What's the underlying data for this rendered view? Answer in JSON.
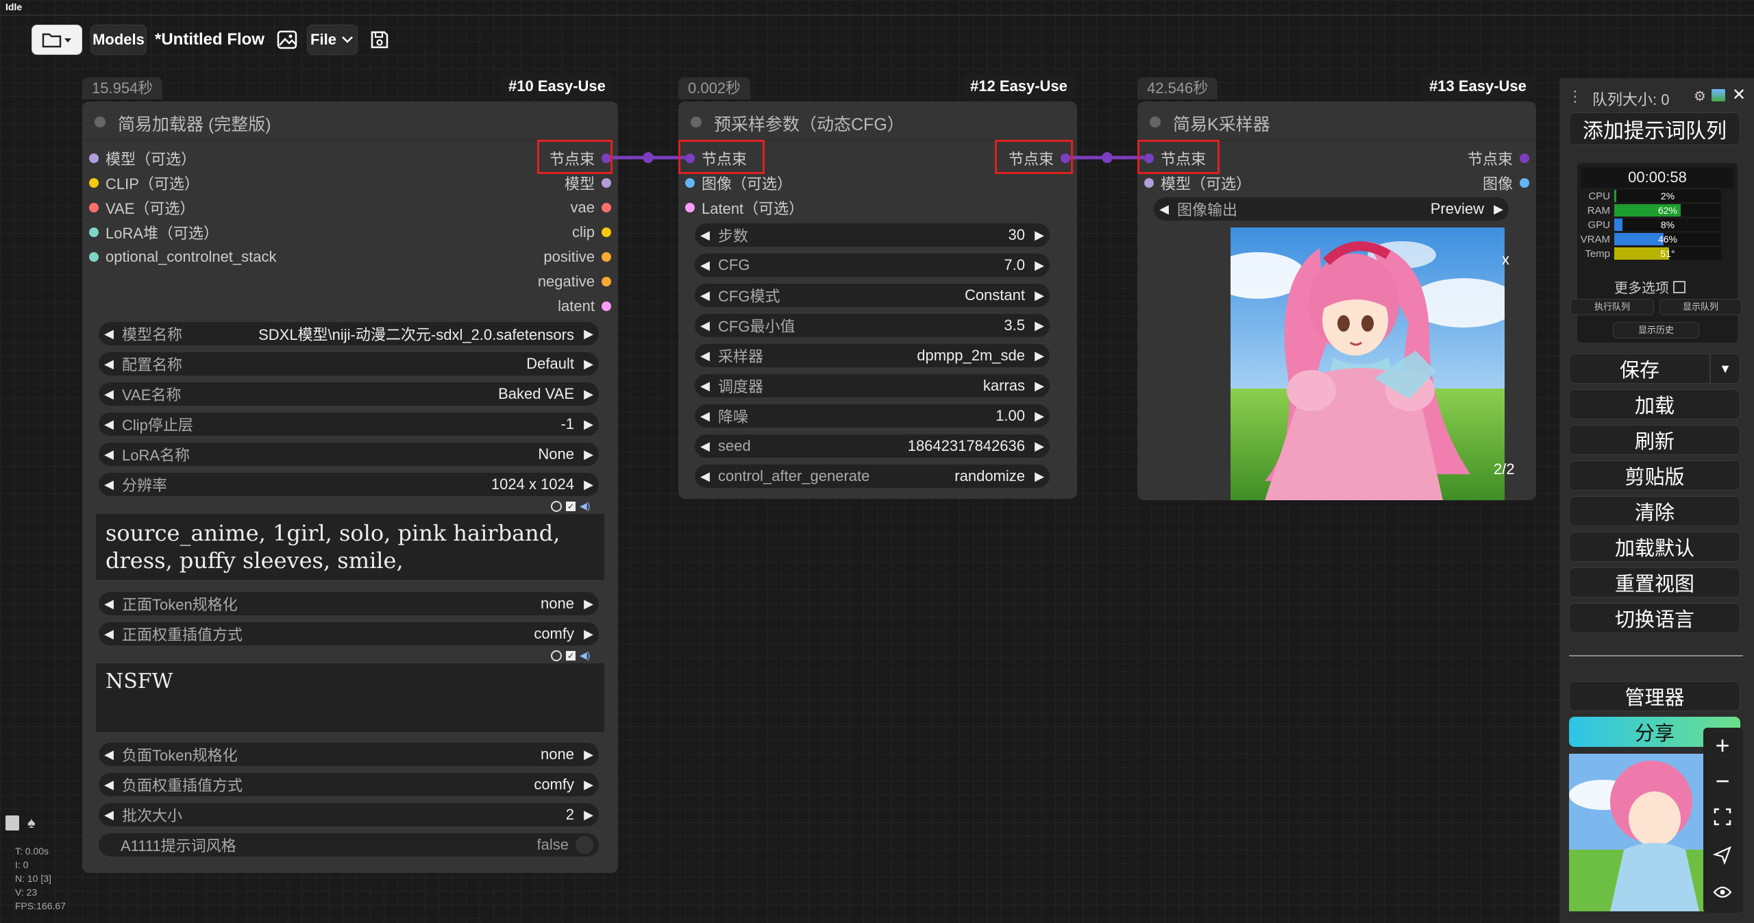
{
  "app": {
    "status": "Idle"
  },
  "toolbar": {
    "models_label": "Models",
    "flow_title": "*Untitled Flow",
    "file_label": "File"
  },
  "nodes": {
    "loader": {
      "timer": "15.954秒",
      "badge": "#10 Easy-Use",
      "title": "简易加载器 (完整版)",
      "inputs": [
        "模型（可选）",
        "CLIP（可选）",
        "VAE（可选）",
        "LoRA堆（可选）",
        "optional_controlnet_stack"
      ],
      "outputs": [
        "节点束",
        "模型",
        "vae",
        "clip",
        "positive",
        "negative",
        "latent"
      ],
      "widgets": [
        {
          "label": "模型名称",
          "value": "SDXL模型\\niji-动漫二次元-sdxl_2.0.safetensors"
        },
        {
          "label": "配置名称",
          "value": "Default"
        },
        {
          "label": "VAE名称",
          "value": "Baked VAE"
        },
        {
          "label": "Clip停止层",
          "value": "-1"
        },
        {
          "label": "LoRA名称",
          "value": "None"
        },
        {
          "label": "分辨率",
          "value": "1024 x 1024"
        }
      ],
      "positive_prompt": "source_anime, 1girl, solo, pink hairband, dress, puffy sleeves, smile,",
      "widgets2": [
        {
          "label": "正面Token规格化",
          "value": "none"
        },
        {
          "label": "正面权重插值方式",
          "value": "comfy"
        }
      ],
      "negative_prompt": "NSFW",
      "widgets3": [
        {
          "label": "负面Token规格化",
          "value": "none"
        },
        {
          "label": "负面权重插值方式",
          "value": "comfy"
        },
        {
          "label": "批次大小",
          "value": "2"
        }
      ],
      "toggle": {
        "label": "A1111提示词风格",
        "value": "false"
      }
    },
    "presampler": {
      "timer": "0.002秒",
      "badge": "#12 Easy-Use",
      "title": "预采样参数（动态CFG）",
      "inputs": [
        "节点束",
        "图像（可选）",
        "Latent（可选）"
      ],
      "widgets": [
        {
          "label": "步数",
          "value": "30"
        },
        {
          "label": "CFG",
          "value": "7.0"
        },
        {
          "label": "CFG模式",
          "value": "Constant"
        },
        {
          "label": "CFG最小值",
          "value": "3.5"
        },
        {
          "label": "采样器",
          "value": "dpmpp_2m_sde"
        },
        {
          "label": "调度器",
          "value": "karras"
        },
        {
          "label": "降噪",
          "value": "1.00"
        },
        {
          "label": "seed",
          "value": "18642317842636"
        },
        {
          "label": "control_after_generate",
          "value": "randomize"
        }
      ],
      "output": "节点束"
    },
    "ksampler": {
      "timer": "42.546秒",
      "badge": "#13 Easy-Use",
      "title": "简易K采样器",
      "inputs": [
        "节点束",
        "模型（可选）"
      ],
      "outputs": [
        "节点束",
        "图像"
      ],
      "widgets": [
        {
          "label": "图像输出",
          "value": "Preview"
        }
      ],
      "preview_counter": "2/2",
      "close_label": "x"
    }
  },
  "sidebar": {
    "queue_size": "队列大小: 0",
    "queue_prompt": "添加提示词队列",
    "elapsed": "00:00:58",
    "stats": [
      {
        "label": "CPU",
        "value": "2%",
        "pct": 2,
        "color": "#1e9e2e"
      },
      {
        "label": "RAM",
        "value": "62%",
        "pct": 62,
        "color": "#1e9e2e"
      },
      {
        "label": "GPU",
        "value": "8%",
        "pct": 8,
        "color": "#2f7fe0"
      },
      {
        "label": "VRAM",
        "value": "46%",
        "pct": 46,
        "color": "#2f7fe0"
      },
      {
        "label": "Temp",
        "value": "51°",
        "pct": 51,
        "color": "#b8b300"
      }
    ],
    "more_options": "更多选项",
    "exec_queue": "执行队列",
    "show_queue": "显示队列",
    "show_history": "显示历史",
    "buttons": [
      "保存",
      "加载",
      "刷新",
      "剪贴版",
      "清除",
      "加载默认",
      "重置视图",
      "切换语言"
    ],
    "manager": "管理器",
    "share": "分享"
  },
  "stats_overlay": [
    "T: 0.00s",
    "I: 0",
    "N: 10 [3]",
    "V: 23",
    "FPS:166.67"
  ],
  "colors": {
    "accent_red": "#e02020",
    "link": "#7b3fbf",
    "share_gradient": "#2ec4e8"
  }
}
